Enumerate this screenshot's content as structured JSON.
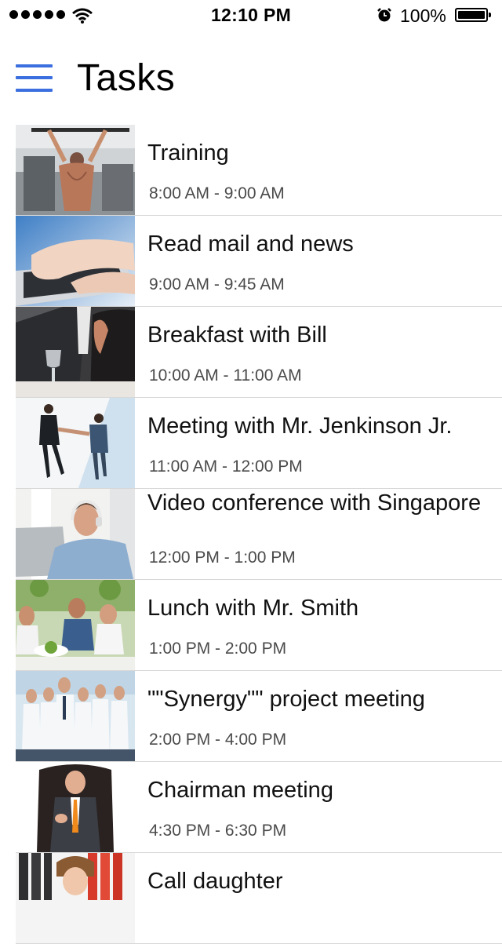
{
  "status_bar": {
    "time": "12:10 PM",
    "battery_percent": "100%",
    "signal_dots": 5,
    "icons": [
      "signal-dots-icon",
      "wifi-icon",
      "alarm-clock-icon",
      "battery-icon"
    ]
  },
  "header": {
    "title": "Tasks",
    "menu_icon": "hamburger-menu-icon",
    "accent_color": "#3b6fe0"
  },
  "tasks": [
    {
      "title": "Training",
      "time": "8:00 AM - 9:00 AM",
      "image": "gym-pullup-photo"
    },
    {
      "title": "Read mail and news",
      "time": "9:00 AM - 9:45 AM",
      "image": "laptop-typing-photo"
    },
    {
      "title": "Breakfast with Bill",
      "time": "10:00 AM - 11:00 AM",
      "image": "business-breakfast-photo"
    },
    {
      "title": "Meeting with Mr. Jenkinson Jr.",
      "time": "11:00 AM - 12:00 PM",
      "image": "handshake-photo"
    },
    {
      "title": "Video conference with Singapore",
      "time": "12:00 PM - 1:00 PM",
      "image": "headset-laptop-photo"
    },
    {
      "title": "Lunch with Mr. Smith",
      "time": "1:00 PM - 2:00 PM",
      "image": "lunch-group-photo"
    },
    {
      "title": "\"\"Synergy\"\" project meeting",
      "time": "2:00 PM - 4:00 PM",
      "image": "business-team-photo"
    },
    {
      "title": "Chairman meeting",
      "time": "4:30 PM - 6:30 PM",
      "image": "chairman-photo"
    },
    {
      "title": "Call daughter",
      "time": "",
      "image": "daughter-photo"
    }
  ]
}
